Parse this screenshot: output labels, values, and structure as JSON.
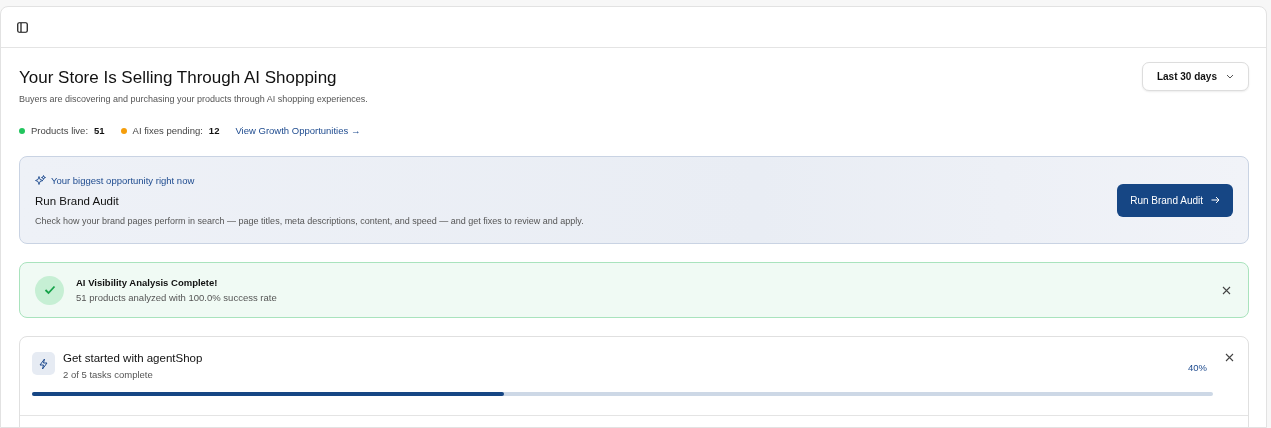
{
  "header": {
    "title": "Your Store Is Selling Through AI Shopping",
    "subtitle": "Buyers are discovering and purchasing your products through AI shopping experiences.",
    "date_range": "Last 30 days"
  },
  "stats": [
    {
      "label": "Products live:",
      "value": "51",
      "color": "#22c55e"
    },
    {
      "label": "AI fixes pending:",
      "value": "12",
      "color": "#f59e0b"
    }
  ],
  "stats_link": "View Growth Opportunities →",
  "opportunity": {
    "eyebrow": "Your biggest opportunity right now",
    "title": "Run Brand Audit",
    "description": "Check how your brand pages perform in search — page titles, meta descriptions, content, and speed — and get fixes to review and apply.",
    "button": "Run Brand Audit"
  },
  "notice": {
    "title": "AI Visibility Analysis Complete!",
    "message": "51 products analyzed with 100.0% success rate"
  },
  "checklist": {
    "title": "Get started with agentShop",
    "progress_text": "2 of 5 tasks complete",
    "percent": "40%",
    "level": 0.4
  }
}
